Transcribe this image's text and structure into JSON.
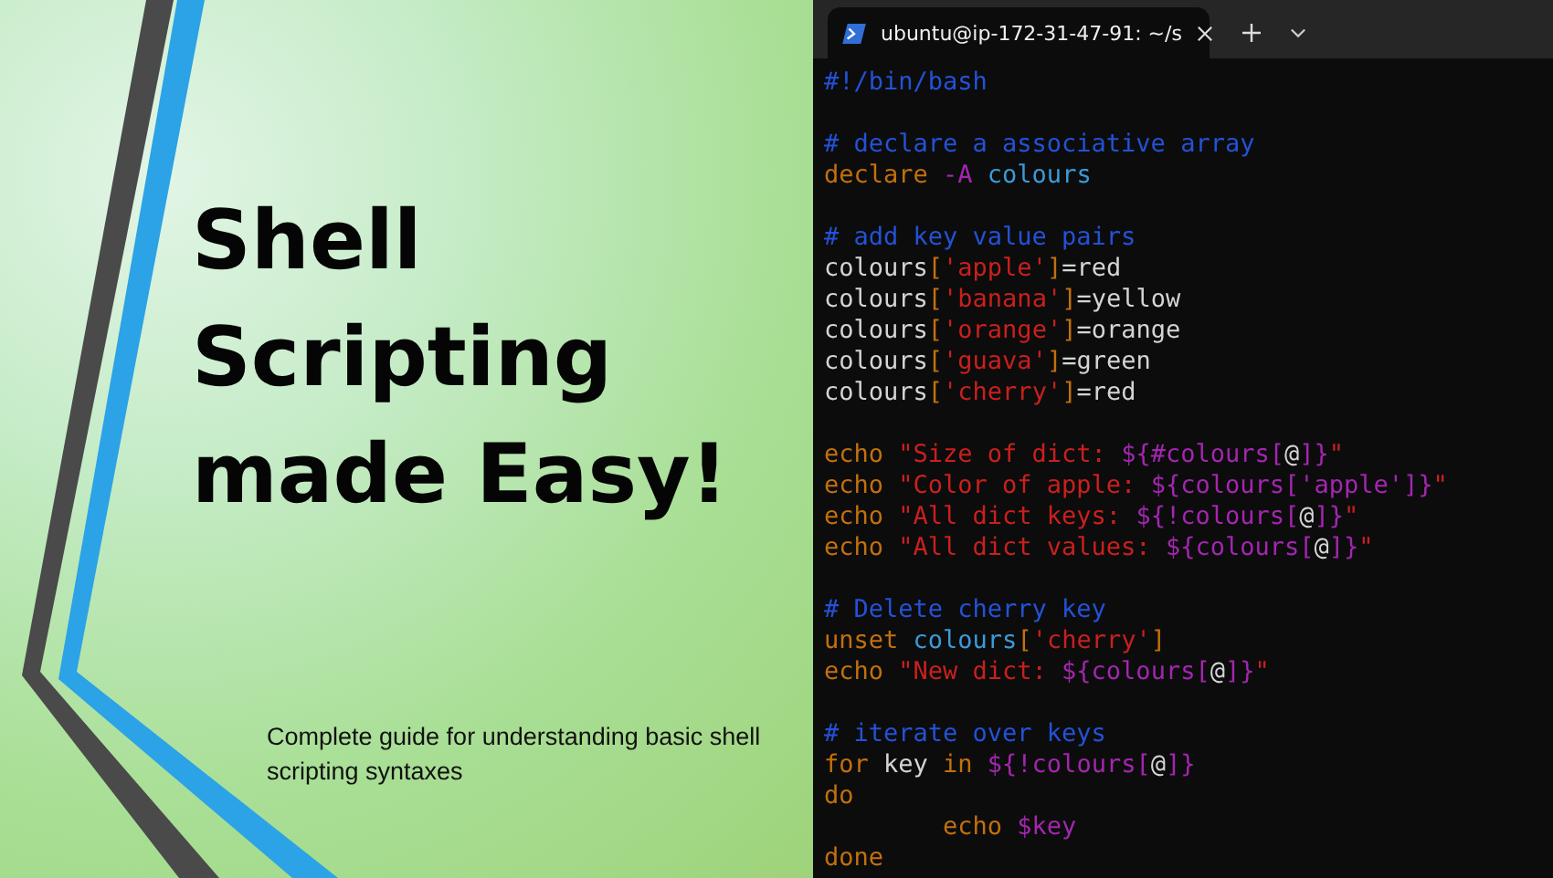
{
  "slide": {
    "title_lines": [
      "Shell",
      "Scripting",
      "made Easy!"
    ],
    "subtitle": "Complete guide for understanding basic shell scripting syntaxes"
  },
  "terminal": {
    "tab": {
      "title": "ubuntu@ip-172-31-47-91: ~/s",
      "selected": true
    },
    "code_blocks": [
      {
        "lines": [
          {
            "tokens": [
              {
                "text": "#!/bin/bash",
                "kind": "comment"
              }
            ]
          }
        ]
      },
      {
        "lines": [
          {
            "tokens": [
              {
                "text": "# declare a associative array",
                "kind": "comment"
              }
            ]
          },
          {
            "tokens": [
              {
                "text": "declare ",
                "kind": "keyword"
              },
              {
                "text": "-A",
                "kind": "expansion"
              },
              {
                "text": " colours",
                "kind": "variable"
              }
            ]
          }
        ]
      },
      {
        "lines": [
          {
            "tokens": [
              {
                "text": "# add key value pairs",
                "kind": "comment"
              }
            ]
          },
          {
            "tokens": [
              {
                "text": "colours",
                "kind": "plain"
              },
              {
                "text": "[",
                "kind": "keyword"
              },
              {
                "text": "'apple'",
                "kind": "string"
              },
              {
                "text": "]",
                "kind": "keyword"
              },
              {
                "text": "=red",
                "kind": "plain"
              }
            ]
          },
          {
            "tokens": [
              {
                "text": "colours",
                "kind": "plain"
              },
              {
                "text": "[",
                "kind": "keyword"
              },
              {
                "text": "'banana'",
                "kind": "string"
              },
              {
                "text": "]",
                "kind": "keyword"
              },
              {
                "text": "=yellow",
                "kind": "plain"
              }
            ]
          },
          {
            "tokens": [
              {
                "text": "colours",
                "kind": "plain"
              },
              {
                "text": "[",
                "kind": "keyword"
              },
              {
                "text": "'orange'",
                "kind": "string"
              },
              {
                "text": "]",
                "kind": "keyword"
              },
              {
                "text": "=orange",
                "kind": "plain"
              }
            ]
          },
          {
            "tokens": [
              {
                "text": "colours",
                "kind": "plain"
              },
              {
                "text": "[",
                "kind": "keyword"
              },
              {
                "text": "'guava'",
                "kind": "string"
              },
              {
                "text": "]",
                "kind": "keyword"
              },
              {
                "text": "=green",
                "kind": "plain"
              }
            ]
          },
          {
            "tokens": [
              {
                "text": "colours",
                "kind": "plain"
              },
              {
                "text": "[",
                "kind": "keyword"
              },
              {
                "text": "'cherry'",
                "kind": "string"
              },
              {
                "text": "]",
                "kind": "keyword"
              },
              {
                "text": "=red",
                "kind": "plain"
              }
            ]
          }
        ]
      },
      {
        "lines": [
          {
            "tokens": [
              {
                "text": "echo ",
                "kind": "keyword"
              },
              {
                "text": "\"Size of dict: ",
                "kind": "string"
              },
              {
                "text": "${#colours[",
                "kind": "expansion"
              },
              {
                "text": "@",
                "kind": "plain"
              },
              {
                "text": "]}",
                "kind": "expansion"
              },
              {
                "text": "\"",
                "kind": "string"
              }
            ]
          },
          {
            "tokens": [
              {
                "text": "echo ",
                "kind": "keyword"
              },
              {
                "text": "\"Color of apple: ",
                "kind": "string"
              },
              {
                "text": "${colours['apple']}",
                "kind": "expansion"
              },
              {
                "text": "\"",
                "kind": "string"
              }
            ]
          },
          {
            "tokens": [
              {
                "text": "echo ",
                "kind": "keyword"
              },
              {
                "text": "\"All dict keys: ",
                "kind": "string"
              },
              {
                "text": "${!colours[",
                "kind": "expansion"
              },
              {
                "text": "@",
                "kind": "plain"
              },
              {
                "text": "]}",
                "kind": "expansion"
              },
              {
                "text": "\"",
                "kind": "string"
              }
            ]
          },
          {
            "tokens": [
              {
                "text": "echo ",
                "kind": "keyword"
              },
              {
                "text": "\"All dict values: ",
                "kind": "string"
              },
              {
                "text": "${colours[",
                "kind": "expansion"
              },
              {
                "text": "@",
                "kind": "plain"
              },
              {
                "text": "]}",
                "kind": "expansion"
              },
              {
                "text": "\"",
                "kind": "string"
              }
            ]
          }
        ]
      },
      {
        "lines": [
          {
            "tokens": [
              {
                "text": "# Delete cherry key",
                "kind": "comment"
              }
            ]
          },
          {
            "tokens": [
              {
                "text": "unset ",
                "kind": "keyword"
              },
              {
                "text": "colours",
                "kind": "variable"
              },
              {
                "text": "[",
                "kind": "keyword"
              },
              {
                "text": "'cherry'",
                "kind": "string"
              },
              {
                "text": "]",
                "kind": "keyword"
              }
            ]
          },
          {
            "tokens": [
              {
                "text": "echo ",
                "kind": "keyword"
              },
              {
                "text": "\"New dict: ",
                "kind": "string"
              },
              {
                "text": "${colours[",
                "kind": "expansion"
              },
              {
                "text": "@",
                "kind": "plain"
              },
              {
                "text": "]}",
                "kind": "expansion"
              },
              {
                "text": "\"",
                "kind": "string"
              }
            ]
          }
        ]
      },
      {
        "lines": [
          {
            "tokens": [
              {
                "text": "# iterate over keys",
                "kind": "comment"
              }
            ]
          },
          {
            "tokens": [
              {
                "text": "for",
                "kind": "keyword"
              },
              {
                "text": " key ",
                "kind": "plain"
              },
              {
                "text": "in ",
                "kind": "keyword"
              },
              {
                "text": "${!colours[",
                "kind": "expansion"
              },
              {
                "text": "@",
                "kind": "plain"
              },
              {
                "text": "]}",
                "kind": "expansion"
              }
            ]
          },
          {
            "tokens": [
              {
                "text": "do",
                "kind": "keyword"
              }
            ]
          },
          {
            "tokens": [
              {
                "text": "        echo ",
                "kind": "keyword"
              },
              {
                "text": "$key",
                "kind": "expansion"
              }
            ]
          },
          {
            "tokens": [
              {
                "text": "done",
                "kind": "keyword"
              }
            ]
          }
        ]
      }
    ]
  }
}
